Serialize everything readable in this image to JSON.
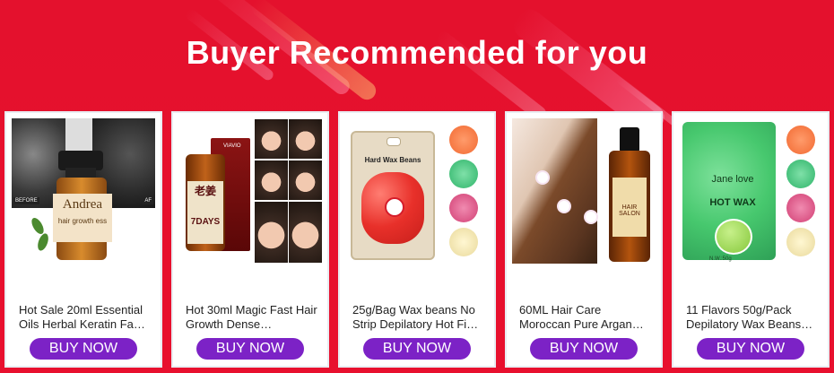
{
  "header": {
    "title": "Buyer Recommended for you"
  },
  "theme": {
    "background": "#e8102e",
    "button_color": "#7c22c6"
  },
  "products": [
    {
      "name": "Hot Sale 20ml Essential Oils Herbal Keratin Fa…",
      "button_label": "BUY NOW",
      "image": {
        "bottle_text": "Andrea",
        "sub_text": "hair growth ess",
        "before_label": "BEFORE",
        "after_label": "AF"
      }
    },
    {
      "name": "Hot 30ml Magic Fast Hair Growth Dense…",
      "button_label": "BUY NOW",
      "image": {
        "brand": "VIAVIO",
        "label": "老姜",
        "days": "7DAYS"
      }
    },
    {
      "name": "25g/Bag Wax beans No Strip Depilatory Hot Fi…",
      "button_label": "BUY NOW",
      "image": {
        "bag_label": "Hard Wax Beans"
      }
    },
    {
      "name": "60ML Hair Care Moroccan Pure Argan…",
      "button_label": "BUY NOW",
      "image": {
        "bottle_text": "HAIR SALON"
      }
    },
    {
      "name": "11 Flavors 50g/Pack Depilatory Wax Beans…",
      "button_label": "BUY NOW",
      "image": {
        "brand": "Jane love",
        "label": "HOT WAX",
        "weight": "N.W.:50g"
      }
    }
  ]
}
